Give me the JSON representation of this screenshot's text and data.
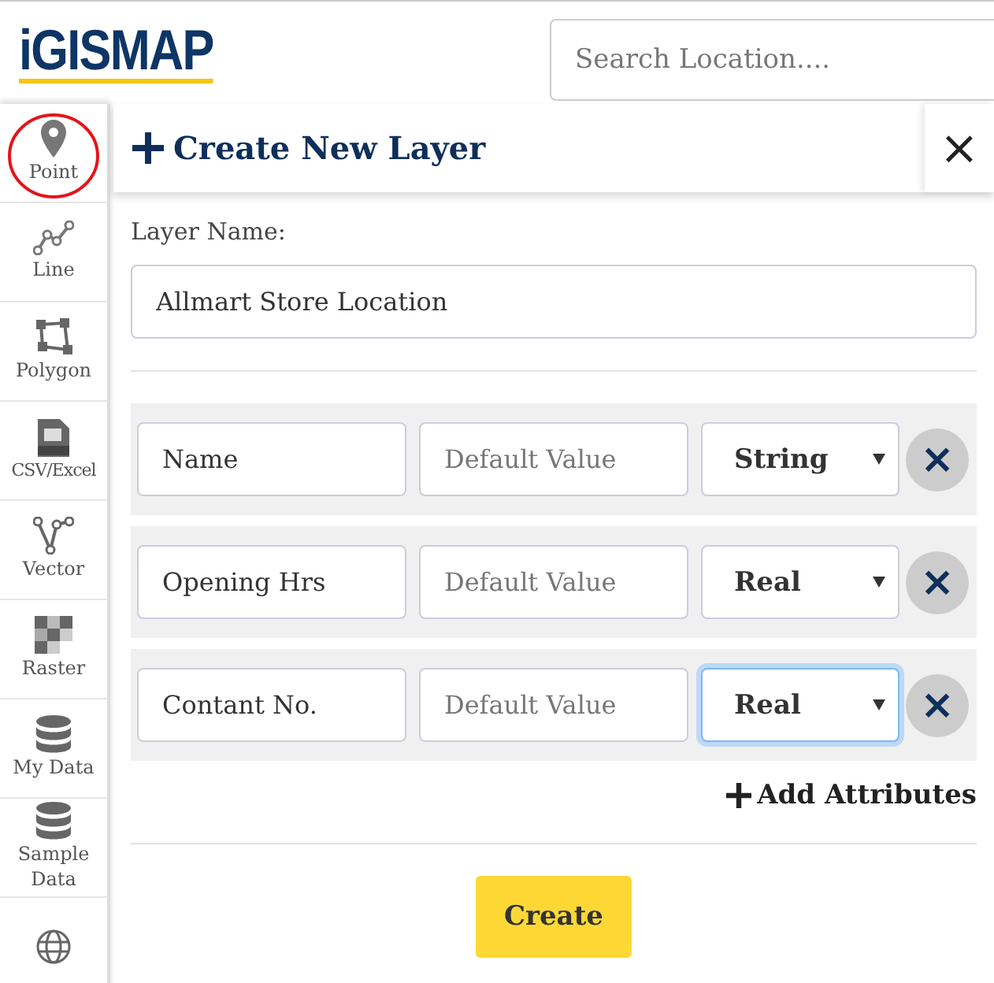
{
  "header": {
    "logo": "iGISMAP",
    "search": {
      "placeholder": "Search Location...."
    }
  },
  "sidebar": {
    "items": [
      {
        "kind": "point",
        "label": "Point",
        "highlighted": true
      },
      {
        "kind": "line",
        "label": "Line",
        "highlighted": false
      },
      {
        "kind": "polygon",
        "label": "Polygon",
        "highlighted": false
      },
      {
        "kind": "csv",
        "label": "CSV/Excel",
        "highlighted": false
      },
      {
        "kind": "vector",
        "label": "Vector",
        "highlighted": false
      },
      {
        "kind": "raster",
        "label": "Raster",
        "highlighted": false
      },
      {
        "kind": "database",
        "label": "My Data",
        "highlighted": false
      },
      {
        "kind": "database",
        "label": "Sample Data",
        "highlighted": false
      },
      {
        "kind": "globe",
        "highlighted": false
      }
    ]
  },
  "panel": {
    "title": "Create New Layer",
    "close": "×",
    "layer_name_label": "Layer Name:",
    "layer_name": "Allmart Store Location",
    "attributes": [
      {
        "name": "Name",
        "default_placeholder": "Default Value",
        "type": "String",
        "focused": false,
        "remove": "×"
      },
      {
        "name": "Opening Hrs",
        "default_placeholder": "Default Value",
        "type": "Real",
        "focused": false,
        "remove": "×"
      },
      {
        "name": "Contant No.",
        "default_placeholder": "Default Value",
        "type": "Real",
        "focused": true,
        "remove": "×"
      }
    ],
    "add_attributes": "Add Attributes",
    "create_button": "Create"
  }
}
